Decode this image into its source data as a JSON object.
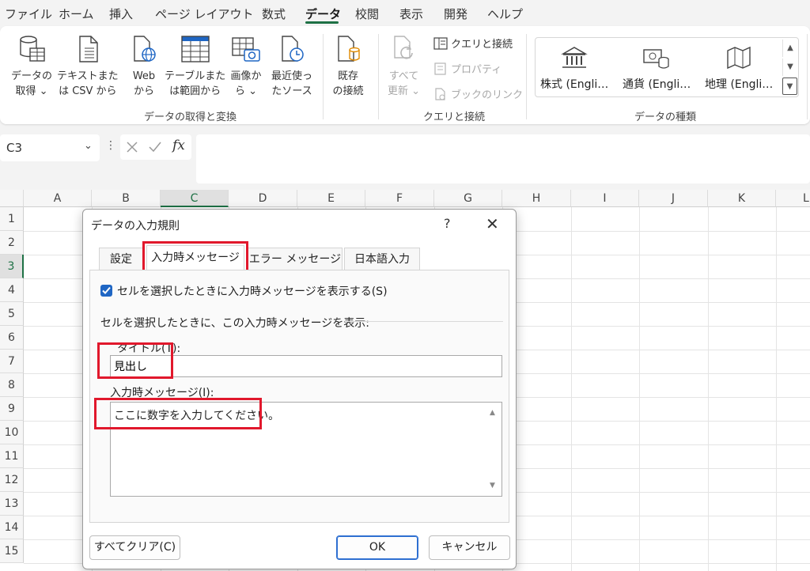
{
  "menu": {
    "tabs": [
      "ファイル",
      "ホーム",
      "挿入",
      "ページ レイアウト",
      "数式",
      "データ",
      "校閲",
      "表示",
      "開発",
      "ヘルプ"
    ],
    "active_tab": "データ"
  },
  "ribbon": {
    "get_transform": {
      "get_data_l1": "データの",
      "get_data_l2": "取得 ⌄",
      "text_csv_l1": "テキストまた",
      "text_csv_l2": "は CSV から",
      "web_l1": "Web",
      "web_l2": "から",
      "table_l1": "テーブルまた",
      "table_l2": "は範囲から",
      "image_l1": "画像か",
      "image_l2": "ら ⌄",
      "recent_l1": "最近使っ",
      "recent_l2": "たソース",
      "existing_l1": "既存",
      "existing_l2": "の接続",
      "group_label": "データの取得と変換"
    },
    "queries": {
      "refresh_l1": "すべて",
      "refresh_l2": "更新 ⌄",
      "queries_conn": "クエリと接続",
      "properties": "プロパティ",
      "edit_links": "ブックのリンク",
      "group_label": "クエリと接続"
    },
    "datatypes": {
      "stocks": "株式 (Engli…",
      "currency": "通貨 (Engli…",
      "geography": "地理 (Engli…",
      "group_label": "データの種類"
    }
  },
  "formula_bar": {
    "name_box": "C3",
    "formula": ""
  },
  "grid": {
    "columns": [
      "A",
      "B",
      "C",
      "D",
      "E",
      "F",
      "G",
      "H",
      "I",
      "J",
      "K",
      "L"
    ],
    "rows": [
      "1",
      "2",
      "3",
      "4",
      "5",
      "6",
      "7",
      "8",
      "9",
      "10",
      "11",
      "12",
      "13",
      "14",
      "15"
    ],
    "selected_cell": "C3"
  },
  "dialog": {
    "title": "データの入力規則",
    "help": "?",
    "close": "✕",
    "tabs": [
      "設定",
      "入力時メッセージ",
      "エラー メッセージ",
      "日本語入力"
    ],
    "active_tab": "入力時メッセージ",
    "show_message_checkbox": "セルを選択したときに入力時メッセージを表示する(S)",
    "show_message_checked": true,
    "section_label": "セルを選択したときに、この入力時メッセージを表示:",
    "title_label": "タイトル(T):",
    "title_value": "見出し",
    "message_label": "入力時メッセージ(I):",
    "message_value": "ここに数字を入力してください。",
    "clear_all": "すべてクリア(C)",
    "ok": "OK",
    "cancel": "キャンセル"
  },
  "colors": {
    "accent_green": "#1e7145",
    "highlight_red": "#e1182c",
    "checkbox_blue": "#1f66c4"
  }
}
